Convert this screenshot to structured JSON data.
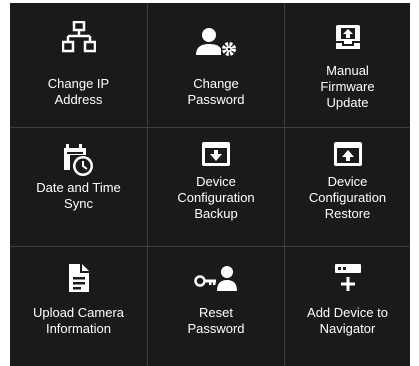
{
  "tiles": [
    {
      "label": "Change IP\nAddress",
      "icon": "network-icon"
    },
    {
      "label": "Change\nPassword",
      "icon": "user-gear-icon"
    },
    {
      "label": "Manual\nFirmware\nUpdate",
      "icon": "firmware-upload-icon"
    },
    {
      "label": "Date and Time\nSync",
      "icon": "calendar-clock-icon"
    },
    {
      "label": "Device\nConfiguration\nBackup",
      "icon": "download-box-icon"
    },
    {
      "label": "Device\nConfiguration\nRestore",
      "icon": "upload-box-icon"
    },
    {
      "label": "Upload Camera\nInformation",
      "icon": "document-icon"
    },
    {
      "label": "Reset\nPassword",
      "icon": "key-user-icon"
    },
    {
      "label": "Add Device to\nNavigator",
      "icon": "add-device-icon"
    }
  ],
  "colors": {
    "background": "#1a1a1a",
    "grid_line": "#3f3f3f",
    "foreground": "#ffffff"
  }
}
